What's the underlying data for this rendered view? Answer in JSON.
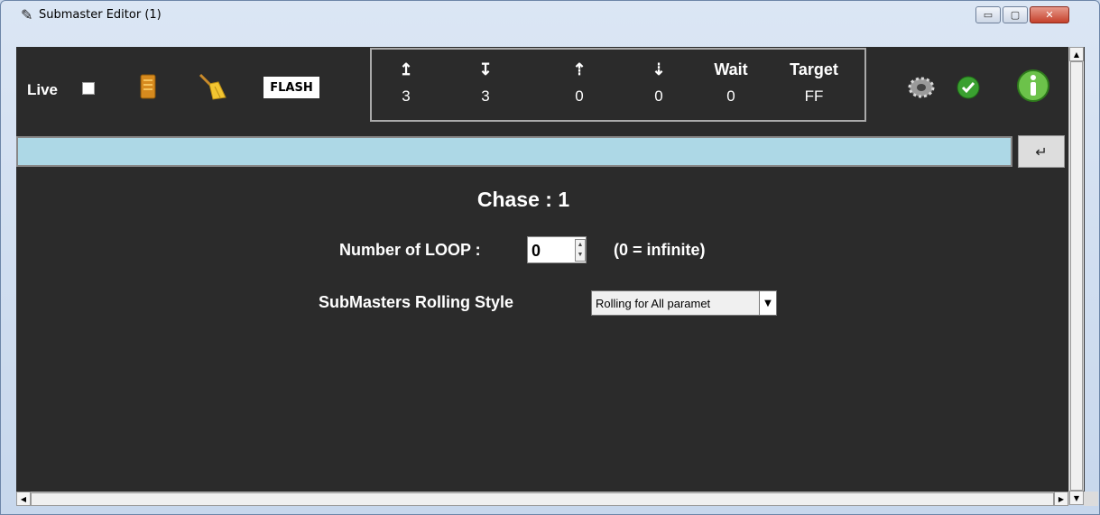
{
  "window": {
    "title": "Submaster Editor (1)",
    "title_icon": "feather-icon",
    "controls": {
      "minimize": "▭",
      "maximize": "▢",
      "close": "✕"
    }
  },
  "toolbar": {
    "live_label": "Live",
    "live_checked": false,
    "flash_label": "FLASH",
    "icons": [
      "memory-card-icon",
      "broom-icon",
      "gear-icon",
      "check-circle-icon",
      "info-icon"
    ]
  },
  "stats": {
    "columns": [
      {
        "head_icon": "up-arrow-icon",
        "head": "↥",
        "value": "3"
      },
      {
        "head_icon": "down-arrow-icon",
        "head": "↧",
        "value": "3"
      },
      {
        "head_icon": "dotted-up-arrow-icon",
        "head": "⇡",
        "value": "0"
      },
      {
        "head_icon": "dotted-down-arrow-icon",
        "head": "⇣",
        "value": "0"
      },
      {
        "head": "Wait",
        "value": "0"
      },
      {
        "head": "Target",
        "value": "FF"
      }
    ]
  },
  "command": {
    "value": "",
    "enter_icon": "↵"
  },
  "main": {
    "chase_title": "Chase : 1",
    "loop_label": "Number of LOOP :",
    "loop_value": "0",
    "loop_hint": "(0 = infinite)",
    "rolling_label": "SubMasters Rolling Style",
    "rolling_value": "Rolling for All paramet"
  },
  "colors": {
    "background": "#2b2b2b",
    "command_bar": "#add8e6",
    "check_green": "#3aa030",
    "info_green": "#6cc24a"
  }
}
